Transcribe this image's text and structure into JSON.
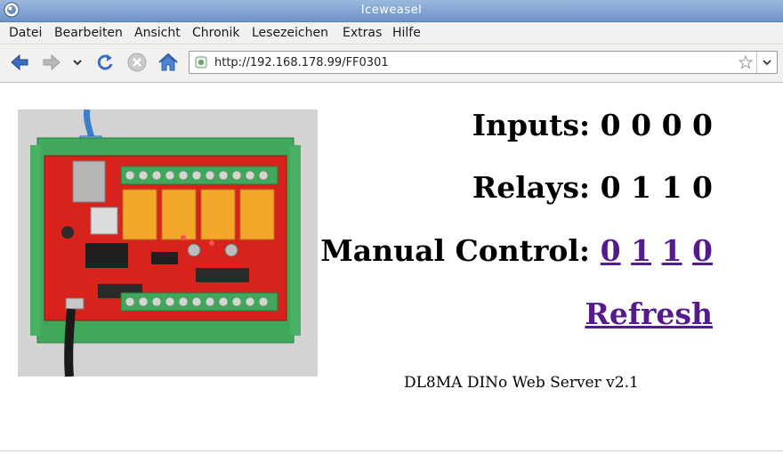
{
  "window": {
    "title": "Iceweasel"
  },
  "menu": {
    "items": [
      {
        "label": "Datei"
      },
      {
        "label": "Bearbeiten"
      },
      {
        "label": "Ansicht"
      },
      {
        "label": "Chronik"
      },
      {
        "label": "Lesezeichen"
      },
      {
        "label": "Extras"
      },
      {
        "label": "Hilfe"
      }
    ]
  },
  "toolbar": {
    "url": "http://192.168.178.99/FF0301",
    "icons": [
      "back-arrow-icon",
      "forward-arrow-icon",
      "history-dropdown-icon",
      "reload-icon",
      "stop-icon",
      "home-icon",
      "site-identity-icon",
      "bookmark-star-icon",
      "url-dropdown-icon"
    ]
  },
  "page": {
    "inputs": {
      "label": "Inputs:",
      "values": [
        "0",
        "0",
        "0",
        "0"
      ]
    },
    "relays": {
      "label": "Relays:",
      "values": [
        "0",
        "1",
        "1",
        "0"
      ]
    },
    "manual": {
      "label": "Manual Control:",
      "links": [
        "0",
        "1",
        "1",
        "0"
      ]
    },
    "refresh": {
      "label": "Refresh"
    },
    "footer": "DL8MA DINo Web Server v2.1"
  },
  "colors": {
    "link": "#551a8b",
    "titlebar": "#7f9fcf"
  }
}
